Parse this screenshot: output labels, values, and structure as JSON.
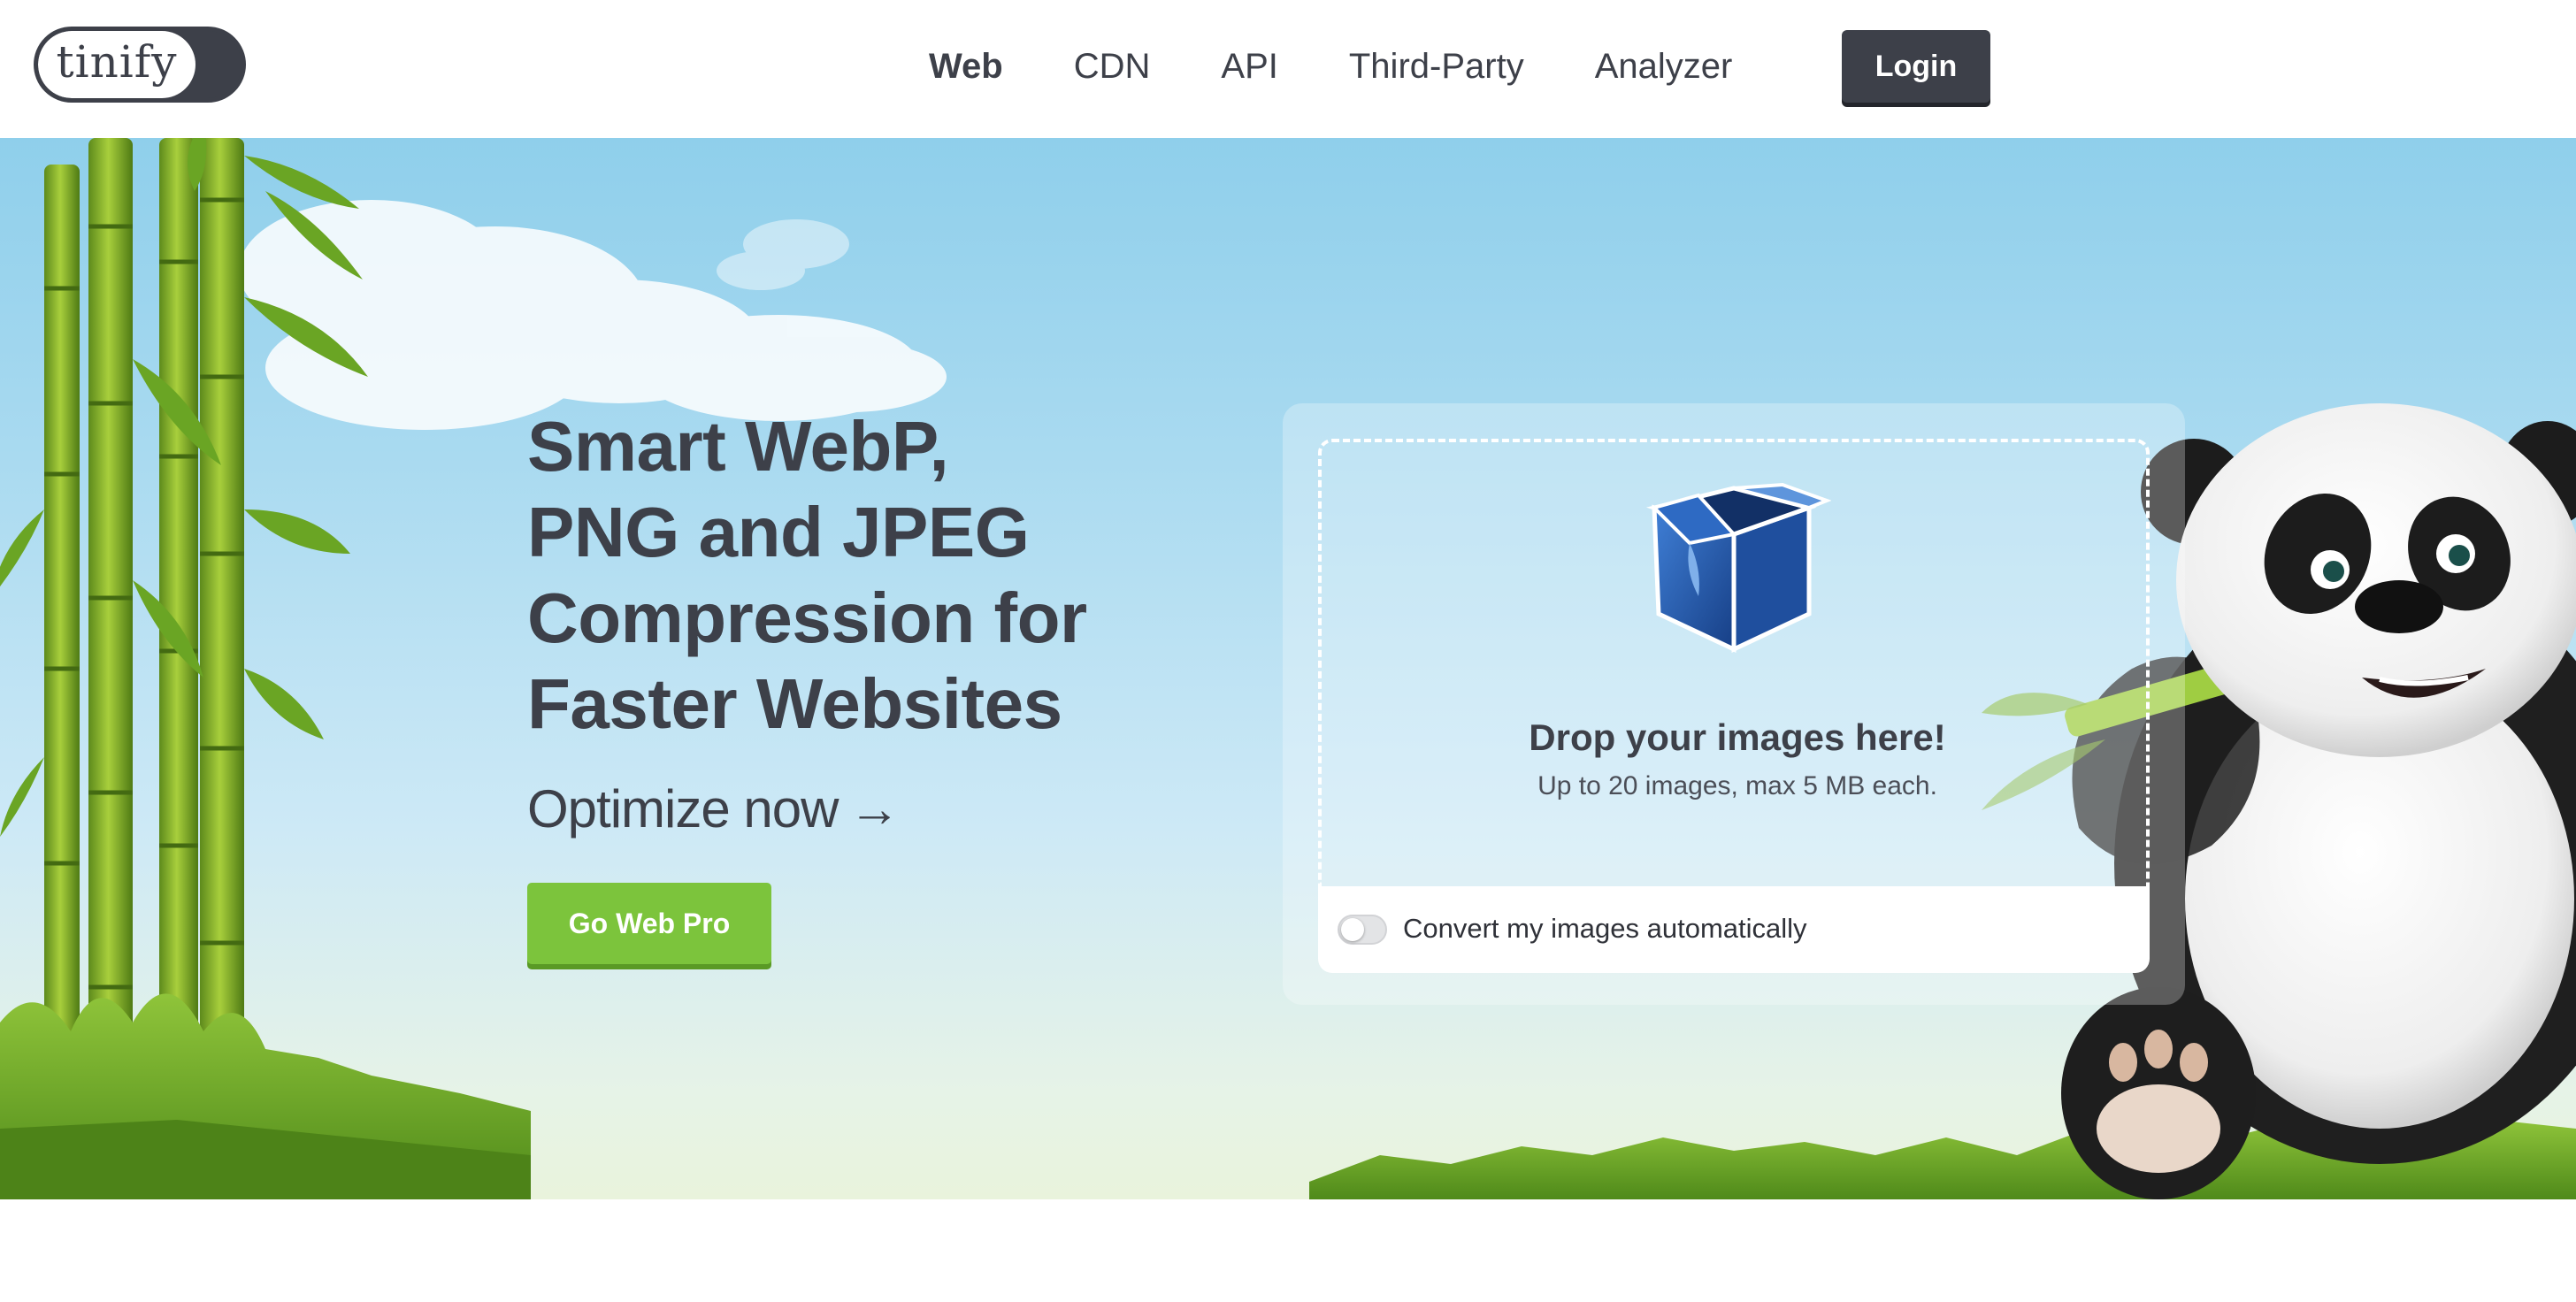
{
  "logo": {
    "text": "tinify"
  },
  "nav": {
    "items": [
      {
        "label": "Web",
        "active": true
      },
      {
        "label": "CDN",
        "active": false
      },
      {
        "label": "API",
        "active": false
      },
      {
        "label": "Third-Party",
        "active": false
      },
      {
        "label": "Analyzer",
        "active": false
      }
    ],
    "login_label": "Login"
  },
  "hero": {
    "headline_lines": [
      "Smart WebP,",
      "PNG and JPEG",
      "Compression for",
      "Faster Websites"
    ],
    "optimize_label": "Optimize now",
    "optimize_arrow": "→",
    "pro_button_label": "Go Web Pro"
  },
  "upload": {
    "icon": "open-box-icon",
    "title": "Drop your images here!",
    "subtitle": "Up to 20 images, max 5 MB each.",
    "convert_label": "Convert my images automatically",
    "convert_enabled": false
  },
  "colors": {
    "primary_dark": "#3d4049",
    "accent_green": "#7cc43c",
    "sky_top": "#8fcfeb",
    "box_blue": "#2a62b8"
  }
}
